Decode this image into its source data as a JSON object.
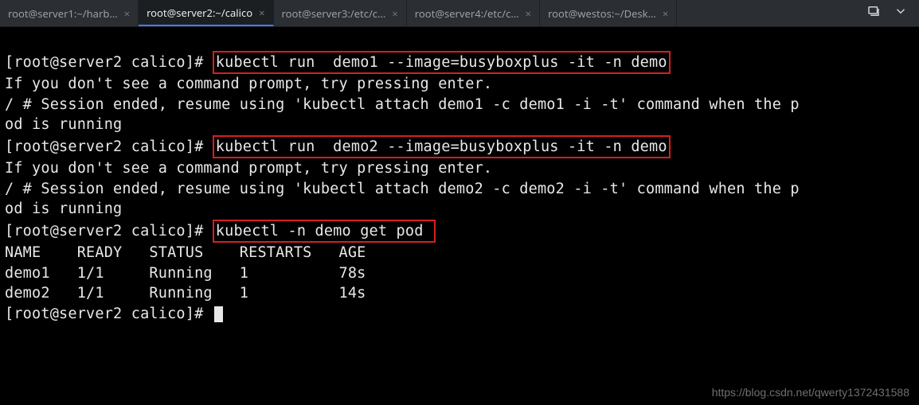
{
  "tabs": [
    {
      "label": "root@server1:~/harb…",
      "active": false
    },
    {
      "label": "root@server2:~/calico",
      "active": true
    },
    {
      "label": "root@server3:/etc/c…",
      "active": false
    },
    {
      "label": "root@server4:/etc/c…",
      "active": false
    },
    {
      "label": "root@westos:~/Desk…",
      "active": false
    }
  ],
  "close_glyph": "×",
  "prompt": "[root@server2 calico]# ",
  "cmd1": "kubectl run  demo1 --image=busyboxplus -it -n demo",
  "out1a": "If you don't see a command prompt, try pressing enter.",
  "out1b": "/ # Session ended, resume using 'kubectl attach demo1 -c demo1 -i -t' command when the p",
  "out1c": "od is running",
  "cmd2": "kubectl run  demo2 --image=busyboxplus -it -n demo",
  "out2a": "If you don't see a command prompt, try pressing enter.",
  "out2b": "/ # Session ended, resume using 'kubectl attach demo2 -c demo2 -i -t' command when the p",
  "out2c": "od is running",
  "cmd3": "kubectl -n demo get pod ",
  "table_header": "NAME    READY   STATUS    RESTARTS   AGE",
  "table_rows": [
    "demo1   1/1     Running   1          78s",
    "demo2   1/1     Running   1          14s"
  ],
  "watermark": "https://blog.csdn.net/qwerty1372431588"
}
